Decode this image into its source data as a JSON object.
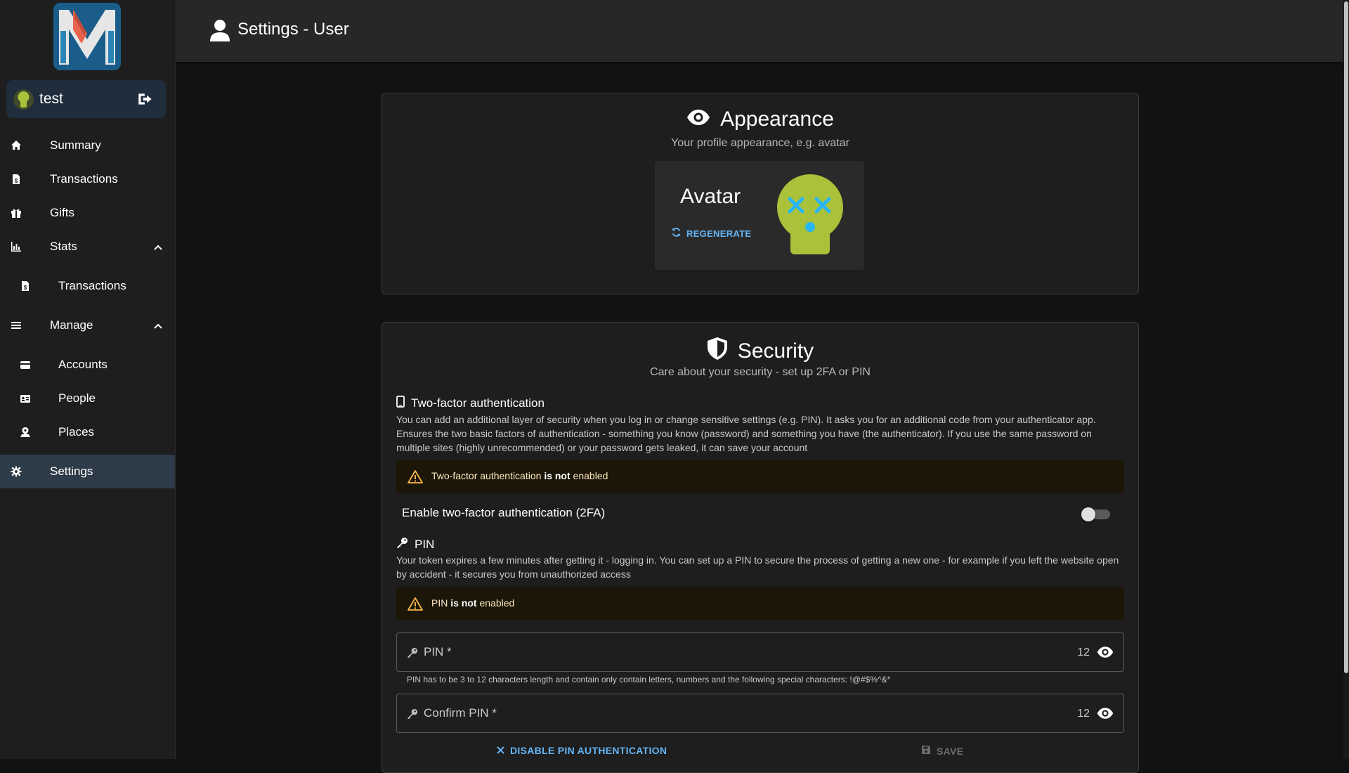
{
  "app": {
    "user": {
      "name": "test"
    },
    "page_title": "Settings - User"
  },
  "sidebar": {
    "items": [
      {
        "label": "Summary",
        "icon": "home-icon"
      },
      {
        "label": "Transactions",
        "icon": "receipt-icon"
      },
      {
        "label": "Gifts",
        "icon": "gift-icon"
      },
      {
        "label": "Stats",
        "icon": "chart-icon",
        "expanded": true
      },
      {
        "label": "Transactions",
        "icon": "receipt-icon"
      },
      {
        "label": "Manage",
        "icon": "menu-icon",
        "expanded": true
      },
      {
        "label": "Accounts",
        "icon": "wallet-icon"
      },
      {
        "label": "People",
        "icon": "contact-card-icon"
      },
      {
        "label": "Places",
        "icon": "map-marker-icon"
      },
      {
        "label": "Settings",
        "icon": "gear-icon",
        "active": true
      }
    ]
  },
  "appearance": {
    "title": "Appearance",
    "subtitle": "Your profile appearance, e.g. avatar",
    "avatar_label": "Avatar",
    "regenerate_label": "REGENERATE"
  },
  "security": {
    "title": "Security",
    "subtitle": "Care about your security - set up 2FA or PIN",
    "twofa": {
      "heading": "Two-factor authentication",
      "description": "You can add an additional layer of security when you log in or change sensitive settings (e.g. PIN). It asks you for an additional code from your authenticator app. Ensures the two basic factors of authentication - something you know (password) and something you have (the authenticator). If you use the same password on multiple sites (highly unrecommended) or your password gets leaked, it can save your account",
      "alert_prefix": "Two-factor authentication ",
      "alert_bold": "is not",
      "alert_suffix": " enabled",
      "toggle_label": "Enable two-factor authentication (2FA)",
      "enabled": false
    },
    "pin": {
      "heading": "PIN",
      "description": "Your token expires a few minutes after getting it - logging in. You can set up a PIN to secure the process of getting a new one - for example if you left the website open by accident - it secures you from unauthorized access",
      "alert_prefix": "PIN ",
      "alert_bold": "is not",
      "alert_suffix": " enabled",
      "field_label": "PIN *",
      "field_counter": "12",
      "hint": "PIN has to be 3 to 12 characters length and contain only contain letters, numbers and the following special characters: !@#$%^&*",
      "confirm_label": "Confirm PIN *",
      "confirm_counter": "12",
      "disable_label": "DISABLE PIN AUTHENTICATION",
      "save_label": "SAVE"
    }
  },
  "colors": {
    "accent": "#64b5f6",
    "warning": "#ffb74d",
    "active_nav": "#2e3b48"
  }
}
